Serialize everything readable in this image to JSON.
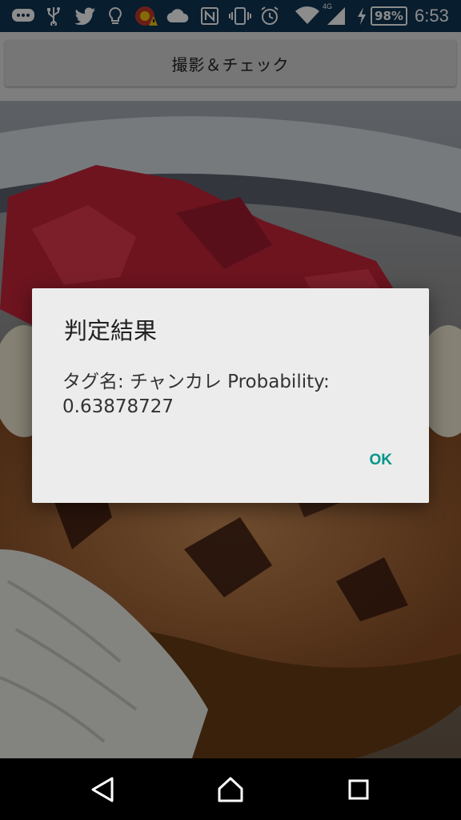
{
  "status_bar": {
    "network_type": "4G",
    "battery_percent": "98%",
    "time": "6:53",
    "icons": [
      "messenger-icon",
      "usb-icon",
      "twitter-icon",
      "lightbulb-icon",
      "game-alert-icon",
      "cloud-icon",
      "nfc-icon",
      "vibrate-icon",
      "alarm-icon",
      "wifi-icon",
      "signal-icon",
      "charging-icon",
      "battery-icon"
    ]
  },
  "app": {
    "capture_button_label": "撮影＆チェック"
  },
  "dialog": {
    "title": "判定結果",
    "message": "タグ名: チャンカレ Probability: 0.63878727",
    "ok_label": "OK"
  },
  "navigation": {
    "icons": [
      "back-icon",
      "home-icon",
      "recents-icon"
    ]
  },
  "colors": {
    "status_bar": "#0f3554",
    "accent": "#009688",
    "dialog_bg": "#ececec"
  }
}
